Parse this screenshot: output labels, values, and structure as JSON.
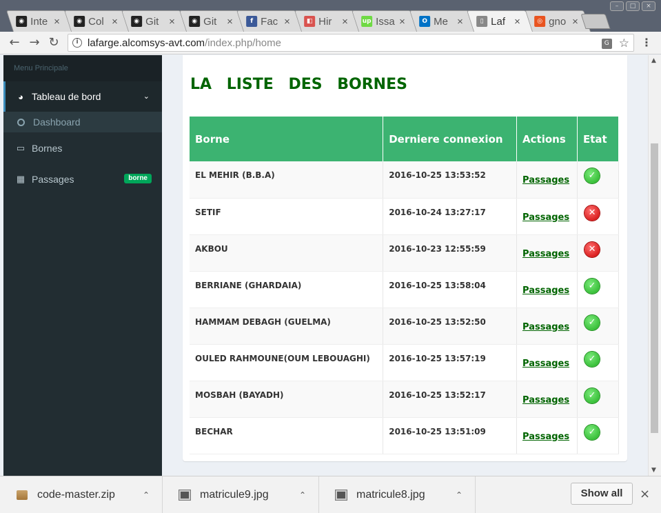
{
  "browser": {
    "tabs": [
      {
        "title": "Inte",
        "favicon": "github-icon",
        "favicon_color": "#222222",
        "favicon_glyph": "◉"
      },
      {
        "title": "Col",
        "favicon": "github-icon",
        "favicon_color": "#222222",
        "favicon_glyph": "◉"
      },
      {
        "title": "Git",
        "favicon": "github-icon",
        "favicon_color": "#222222",
        "favicon_glyph": "◉"
      },
      {
        "title": "Git",
        "favicon": "github-icon",
        "favicon_color": "#222222",
        "favicon_glyph": "◉"
      },
      {
        "title": "Fac",
        "favicon": "facebook-icon",
        "favicon_color": "#3b5998",
        "favicon_glyph": "f"
      },
      {
        "title": "Hir",
        "favicon": "hired-icon",
        "favicon_color": "#d9534f",
        "favicon_glyph": "◧"
      },
      {
        "title": "Issa",
        "favicon": "upwork-icon",
        "favicon_color": "#6fda44",
        "favicon_glyph": "up"
      },
      {
        "title": "Me",
        "favicon": "outlook-icon",
        "favicon_color": "#0072c6",
        "favicon_glyph": "O"
      },
      {
        "title": "Laf",
        "favicon": "page-icon",
        "favicon_color": "#888888",
        "favicon_glyph": "▯",
        "active": true
      },
      {
        "title": "gno",
        "favicon": "ubuntu-icon",
        "favicon_color": "#e95420",
        "favicon_glyph": "◎"
      }
    ],
    "close_glyph": "×",
    "url_host": "lafarge.alcomsys-avt.com",
    "url_path": "/index.php/home"
  },
  "sidebar": {
    "header": "Menu Principale",
    "items": [
      {
        "label": "Tableau de bord",
        "icon": "dashboard-icon"
      },
      {
        "label": "Dashboard",
        "icon": "circle-icon"
      },
      {
        "label": "Bornes",
        "icon": "laptop-icon"
      },
      {
        "label": "Passages",
        "icon": "grid-icon",
        "badge": "borne"
      }
    ]
  },
  "main": {
    "title": "LA LISTE DES BORNES",
    "table": {
      "headers": [
        "Borne",
        "Derniere connexion",
        "Actions",
        "Etat"
      ],
      "rows": [
        {
          "borne": "EL MEHIR (B.B.A)",
          "date": "2016-10-25 13:53:52",
          "action": "Passages",
          "etat": "ok"
        },
        {
          "borne": "SETIF",
          "date": "2016-10-24 13:27:17",
          "action": "Passages",
          "etat": "ko"
        },
        {
          "borne": "AKBOU",
          "date": "2016-10-23 12:55:59",
          "action": "Passages",
          "etat": "ko"
        },
        {
          "borne": "BERRIANE (GHARDAIA)",
          "date": "2016-10-25 13:58:04",
          "action": "Passages",
          "etat": "ok"
        },
        {
          "borne": "HAMMAM DEBAGH (GUELMA)",
          "date": "2016-10-25 13:52:50",
          "action": "Passages",
          "etat": "ok"
        },
        {
          "borne": "OULED RAHMOUNE(OUM LEBOUAGHI)",
          "date": "2016-10-25 13:57:19",
          "action": "Passages",
          "etat": "ok"
        },
        {
          "borne": "MOSBAH (BAYADH)",
          "date": "2016-10-25 13:52:17",
          "action": "Passages",
          "etat": "ok"
        },
        {
          "borne": "BECHAR",
          "date": "2016-10-25 13:51:09",
          "action": "Passages",
          "etat": "ok"
        }
      ]
    },
    "status_colors": {
      "ok": "#2bbd2b",
      "ko": "#dd0000"
    }
  },
  "downloads": {
    "items": [
      {
        "name": "code-master.zip",
        "icon": "zip-icon"
      },
      {
        "name": "matricule9.jpg",
        "icon": "image-file-icon"
      },
      {
        "name": "matricule8.jpg",
        "icon": "image-file-icon"
      }
    ],
    "show_all": "Show all"
  }
}
